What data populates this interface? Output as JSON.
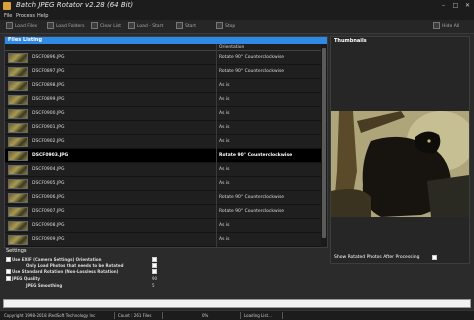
{
  "window": {
    "title": "Batch JPEG Rotator v2.28 (64 Bit)"
  },
  "menu": [
    "File",
    "Process",
    "Help"
  ],
  "toolbar": {
    "load_files": "Load Files",
    "load_folders": "Load Folders",
    "clear_list": "Clear List",
    "load_start": "Load - Start",
    "start": "Start",
    "stop": "Stop",
    "hide_all": "Hide All"
  },
  "files": {
    "header": "Files Listing",
    "col_orientation": "Orientation",
    "rows": [
      {
        "name": "DSCF0896.JPG",
        "orientation": "Rotate 90° Counterclockwise"
      },
      {
        "name": "DSCF0897.JPG",
        "orientation": "Rotate 90° Counterclockwise"
      },
      {
        "name": "DSCF0898.JPG",
        "orientation": "As is"
      },
      {
        "name": "DSCF0899.JPG",
        "orientation": "As is"
      },
      {
        "name": "DSCF0900.JPG",
        "orientation": "As is"
      },
      {
        "name": "DSCF0901.JPG",
        "orientation": "As is"
      },
      {
        "name": "DSCF0902.JPG",
        "orientation": "As is"
      },
      {
        "name": "DSCF0903.JPG",
        "orientation": "Rotate 90° Counterclockwise"
      },
      {
        "name": "DSCF0904.JPG",
        "orientation": "As is"
      },
      {
        "name": "DSCF0905.JPG",
        "orientation": "As is"
      },
      {
        "name": "DSCF0906.JPG",
        "orientation": "Rotate 90° Counterclockwise"
      },
      {
        "name": "DSCF0907.JPG",
        "orientation": "Rotate 90° Counterclockwise"
      },
      {
        "name": "DSCF0908.JPG",
        "orientation": "As is"
      },
      {
        "name": "DSCF0909.JPG",
        "orientation": "As is"
      }
    ]
  },
  "thumbnails": {
    "title": "Thumbnails",
    "show_rotated": "Show Rotated Photos After Processing"
  },
  "settings": {
    "title": "Settings",
    "exif": "Use EXIF (Camera Settings) Orientation",
    "only_load": "Only Load Photos that needs to be Rotated",
    "standard_rotation": "Use Standard Rotation (Non-Lossless Rotation)",
    "jpeg_quality_label": "JPEG Quality",
    "jpeg_quality": "90",
    "jpeg_smoothing_label": "JPEG Smoothing",
    "jpeg_smoothing": "5"
  },
  "status": {
    "copyright": "Copyright 1998-2018 iRedSoft Technology Inc",
    "count": "Count : 261 Files",
    "percent": "0%",
    "loading": "Loading List..."
  },
  "colors": {
    "accent": "#2f8ae6"
  }
}
